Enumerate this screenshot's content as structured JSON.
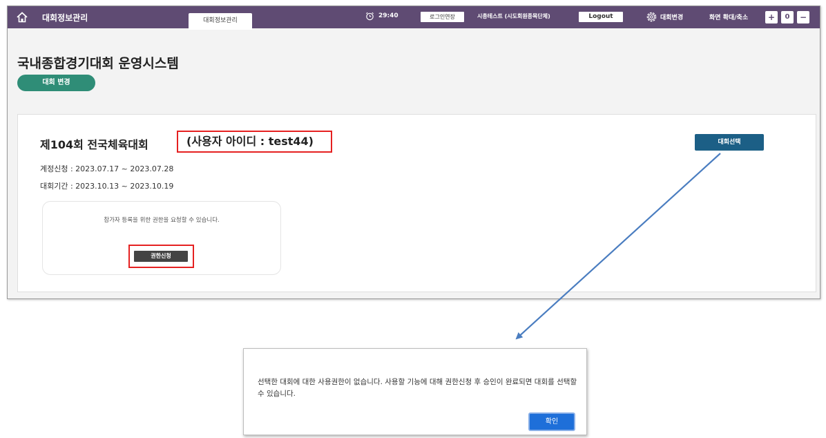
{
  "header": {
    "app_title": "대회정보관리",
    "tab_label": "대회정보관리",
    "timer": "29:40",
    "extend_label": "로그인연장",
    "user_info": "시총테스트 (시도회원종목단체)",
    "logout_label": "Logout",
    "change_label": "대회변경",
    "zoom_label": "화면 확대/축소",
    "zoom_in": "+",
    "zoom_value": "0",
    "zoom_out": "−"
  },
  "main": {
    "system_title": "국내종합경기대회 운영시스템",
    "change_button": "대회 변경"
  },
  "card": {
    "event_title": "제104회 전국체육대회",
    "user_id": "(사용자 아이디 : test44)",
    "registration_period": "계정신청 : 2023.07.17 ~ 2023.07.28",
    "event_period": "대회기간 : 2023.10.13 ~ 2023.10.19",
    "request_message": "참가자 등록을 위한 권한을 요청할 수 있습니다.",
    "request_button": "권한신청",
    "select_button": "대회선택"
  },
  "dialog": {
    "message": "선택한 대회에 대한 사용권한이 없습니다. 사용할 기능에 대해 권한신청 후 승인이 완료되면 대회를 선택할 수 있습니다.",
    "ok_button": "확인"
  },
  "colors": {
    "header_bg": "#5f4b73",
    "accent_green": "#2f8d77",
    "select_blue": "#1c5f86",
    "highlight_red": "#e52020",
    "ok_blue": "#1e6fd9",
    "arrow_blue": "#4a7dc0"
  }
}
